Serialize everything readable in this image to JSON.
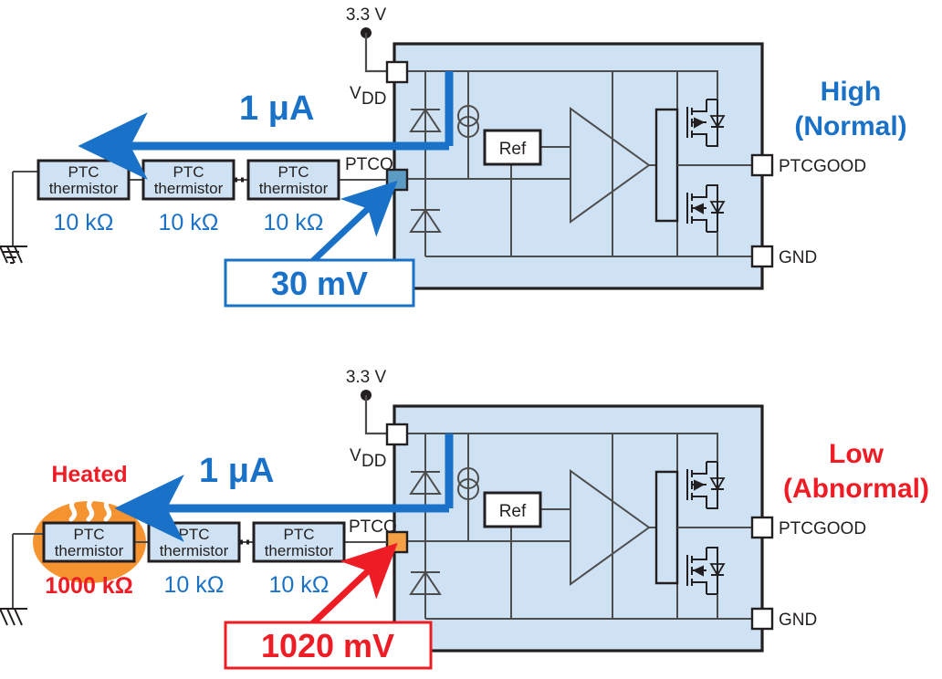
{
  "figure": {
    "title_semantic": "ptc-thermistor-chain-ptcgood-detector",
    "colors": {
      "blue": "#1a72c8",
      "red": "#ee1c25",
      "orange": "#f59331",
      "ic_fill": "#cfe2f3",
      "block_fill": "#cfe2f3",
      "node_blue": "#5b9bc4",
      "node_orange": "#f5a045",
      "line": "#231f20"
    }
  },
  "panels": [
    {
      "id": "normal",
      "supply_label": "3.3 V",
      "vdd_label_main": "V",
      "vdd_label_sub": "DD",
      "current_label": "1 μA",
      "pin_ptco": "PTCO",
      "pin_ptcgood": "PTCGOOD",
      "pin_gnd": "GND",
      "ref_label": "Ref",
      "status_line1": "High",
      "status_line2": "(Normal)",
      "status_color": "#1a72c8",
      "callout_value": "30 mV",
      "callout_color": "#1a72c8",
      "node_color": "#5b9bc4",
      "heated": false,
      "heated_label": "",
      "thermistors": [
        {
          "name": "PTC",
          "name2": "thermistor",
          "value": "10 kΩ",
          "value_color": "#1a72c8",
          "heated": false
        },
        {
          "name": "PTC",
          "name2": "thermistor",
          "value": "10 kΩ",
          "value_color": "#1a72c8",
          "heated": false
        },
        {
          "name": "PTC",
          "name2": "thermistor",
          "value": "10 kΩ",
          "value_color": "#1a72c8",
          "heated": false
        }
      ]
    },
    {
      "id": "abnormal",
      "supply_label": "3.3 V",
      "vdd_label_main": "V",
      "vdd_label_sub": "DD",
      "current_label": "1 μA",
      "pin_ptco": "PTCO",
      "pin_ptcgood": "PTCGOOD",
      "pin_gnd": "GND",
      "ref_label": "Ref",
      "status_line1": "Low",
      "status_line2": "(Abnormal)",
      "status_color": "#ee1c25",
      "callout_value": "1020 mV",
      "callout_color": "#ee1c25",
      "node_color": "#f5a045",
      "heated": true,
      "heated_label": "Heated",
      "thermistors": [
        {
          "name": "PTC",
          "name2": "thermistor",
          "value": "1000 kΩ",
          "value_color": "#ee1c25",
          "heated": true
        },
        {
          "name": "PTC",
          "name2": "thermistor",
          "value": "10 kΩ",
          "value_color": "#1a72c8",
          "heated": false
        },
        {
          "name": "PTC",
          "name2": "thermistor",
          "value": "10 kΩ",
          "value_color": "#1a72c8",
          "heated": false
        }
      ]
    }
  ]
}
